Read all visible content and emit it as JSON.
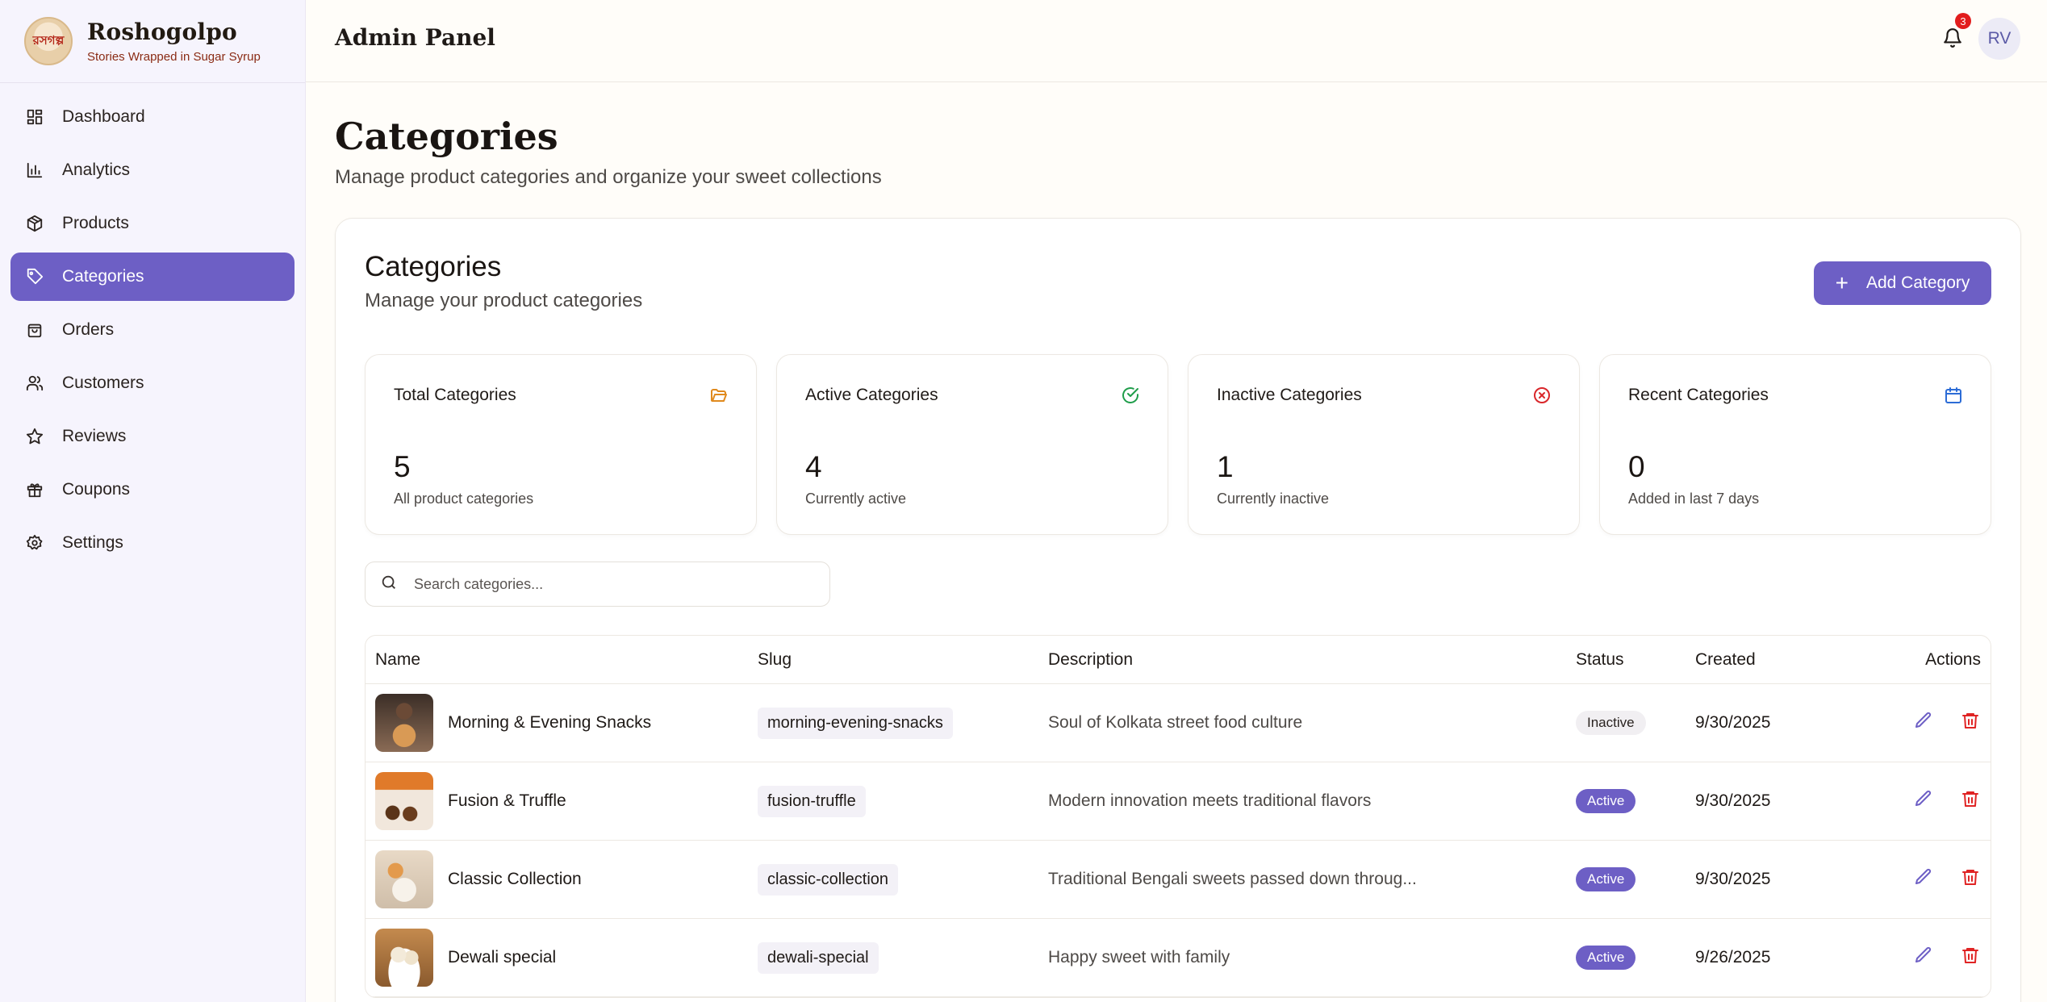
{
  "brand": {
    "name": "Roshogolpo",
    "tagline": "Stories Wrapped in Sugar Syrup",
    "logo_text": "রসগল্প"
  },
  "sidebar": {
    "items": [
      {
        "label": "Dashboard",
        "icon": "dashboard-icon",
        "active": false
      },
      {
        "label": "Analytics",
        "icon": "bar-chart-icon",
        "active": false
      },
      {
        "label": "Products",
        "icon": "package-icon",
        "active": false
      },
      {
        "label": "Categories",
        "icon": "tag-icon",
        "active": true
      },
      {
        "label": "Orders",
        "icon": "shopping-bag-icon",
        "active": false
      },
      {
        "label": "Customers",
        "icon": "users-icon",
        "active": false
      },
      {
        "label": "Reviews",
        "icon": "star-icon",
        "active": false
      },
      {
        "label": "Coupons",
        "icon": "gift-icon",
        "active": false
      },
      {
        "label": "Settings",
        "icon": "gear-icon",
        "active": false
      }
    ]
  },
  "header": {
    "title": "Admin Panel",
    "notification_count": "3",
    "avatar_initials": "RV"
  },
  "page": {
    "title": "Categories",
    "subtitle": "Manage product categories and organize your sweet collections"
  },
  "card": {
    "title": "Categories",
    "subtitle": "Manage your product categories",
    "add_button": "Add Category"
  },
  "stats": [
    {
      "label": "Total Categories",
      "value": "5",
      "desc": "All product categories",
      "icon": "folder-open-icon",
      "color": "#e08a1e"
    },
    {
      "label": "Active Categories",
      "value": "4",
      "desc": "Currently active",
      "icon": "check-circle-icon",
      "color": "#1f9d4a"
    },
    {
      "label": "Inactive Categories",
      "value": "1",
      "desc": "Currently inactive",
      "icon": "x-circle-icon",
      "color": "#d9262a"
    },
    {
      "label": "Recent Categories",
      "value": "0",
      "desc": "Added in last 7 days",
      "icon": "calendar-icon",
      "color": "#2c6cd6"
    }
  ],
  "search": {
    "placeholder": "Search categories..."
  },
  "table": {
    "columns": {
      "name": "Name",
      "slug": "Slug",
      "description": "Description",
      "status": "Status",
      "created": "Created",
      "actions": "Actions"
    },
    "rows": [
      {
        "name": "Morning & Evening Snacks",
        "slug": "morning-evening-snacks",
        "description": "Soul of Kolkata street food culture",
        "status": "Inactive",
        "created": "9/30/2025"
      },
      {
        "name": "Fusion & Truffle",
        "slug": "fusion-truffle",
        "description": "Modern innovation meets traditional flavors",
        "status": "Active",
        "created": "9/30/2025"
      },
      {
        "name": "Classic Collection",
        "slug": "classic-collection",
        "description": "Traditional Bengali sweets passed down throug...",
        "status": "Active",
        "created": "9/30/2025"
      },
      {
        "name": "Dewali special",
        "slug": "dewali-special",
        "description": "Happy sweet with family",
        "status": "Active",
        "created": "9/26/2025"
      }
    ]
  },
  "colors": {
    "accent": "#6d5fc5",
    "edit": "#6d5fc5",
    "delete": "#e02424"
  }
}
